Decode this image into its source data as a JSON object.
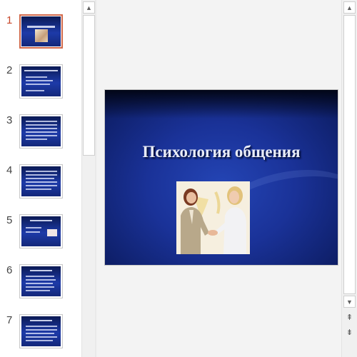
{
  "thumbnails": [
    {
      "number": "1",
      "active": true
    },
    {
      "number": "2",
      "active": false
    },
    {
      "number": "3",
      "active": false
    },
    {
      "number": "4",
      "active": false
    },
    {
      "number": "5",
      "active": false
    },
    {
      "number": "6",
      "active": false
    },
    {
      "number": "7",
      "active": false
    }
  ],
  "slide": {
    "title": "Психология общения"
  },
  "scroll": {
    "up_icon": "▲",
    "down_icon": "▼",
    "prev_slide_icon": "⇞",
    "next_slide_icon": "⇟"
  },
  "colors": {
    "active_accent": "#c8472a",
    "slide_blue": "#1a3298"
  }
}
